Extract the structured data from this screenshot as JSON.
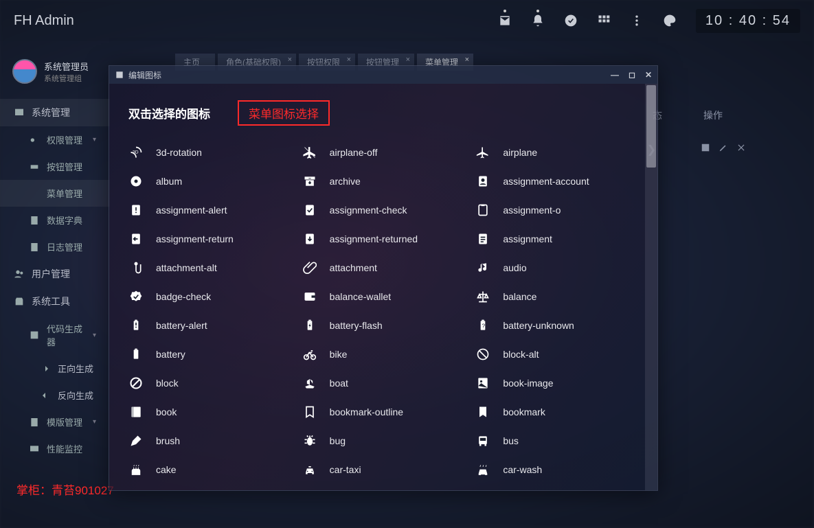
{
  "brand": "FH Admin",
  "clock": "10 : 40 : 54",
  "user": {
    "name": "系统管理员",
    "role": "系统管理组"
  },
  "nav": {
    "sys": "系统管理",
    "perm": "权限管理",
    "btn": "按钮管理",
    "menu": "菜单管理",
    "dict": "数据字典",
    "log": "日志管理",
    "usermgmt": "用户管理",
    "tools": "系统工具",
    "codegen": "代码生成器",
    "fwd": "正向生成",
    "rev": "反向生成",
    "tpl": "模版管理",
    "perf": "性能监控"
  },
  "tabs": [
    {
      "label": "主页",
      "closable": false
    },
    {
      "label": "角色(基础权限)",
      "closable": true
    },
    {
      "label": "按钮权限",
      "closable": true
    },
    {
      "label": "按钮管理",
      "closable": true
    },
    {
      "label": "菜单管理",
      "closable": true,
      "active": true
    }
  ],
  "table_head": {
    "state": "态",
    "ops": "操作"
  },
  "watermark": "掌柜：青苔901027",
  "modal": {
    "title": "编辑图标",
    "picker_title": "双击选择的图标",
    "annotation": "菜单图标选择",
    "icons": [
      [
        {
          "n": "3d-rotation"
        },
        {
          "n": "airplane-off"
        },
        {
          "n": "airplane"
        }
      ],
      [
        {
          "n": "album"
        },
        {
          "n": "archive"
        },
        {
          "n": "assignment-account"
        }
      ],
      [
        {
          "n": "assignment-alert"
        },
        {
          "n": "assignment-check"
        },
        {
          "n": "assignment-o"
        }
      ],
      [
        {
          "n": "assignment-return"
        },
        {
          "n": "assignment-returned"
        },
        {
          "n": "assignment"
        }
      ],
      [
        {
          "n": "attachment-alt"
        },
        {
          "n": "attachment"
        },
        {
          "n": "audio"
        }
      ],
      [
        {
          "n": "badge-check"
        },
        {
          "n": "balance-wallet"
        },
        {
          "n": "balance"
        }
      ],
      [
        {
          "n": "battery-alert"
        },
        {
          "n": "battery-flash"
        },
        {
          "n": "battery-unknown"
        }
      ],
      [
        {
          "n": "battery"
        },
        {
          "n": "bike"
        },
        {
          "n": "block-alt"
        }
      ],
      [
        {
          "n": "block"
        },
        {
          "n": "boat"
        },
        {
          "n": "book-image"
        }
      ],
      [
        {
          "n": "book"
        },
        {
          "n": "bookmark-outline"
        },
        {
          "n": "bookmark"
        }
      ],
      [
        {
          "n": "brush"
        },
        {
          "n": "bug"
        },
        {
          "n": "bus"
        }
      ],
      [
        {
          "n": "cake"
        },
        {
          "n": "car-taxi"
        },
        {
          "n": "car-wash"
        }
      ]
    ]
  }
}
